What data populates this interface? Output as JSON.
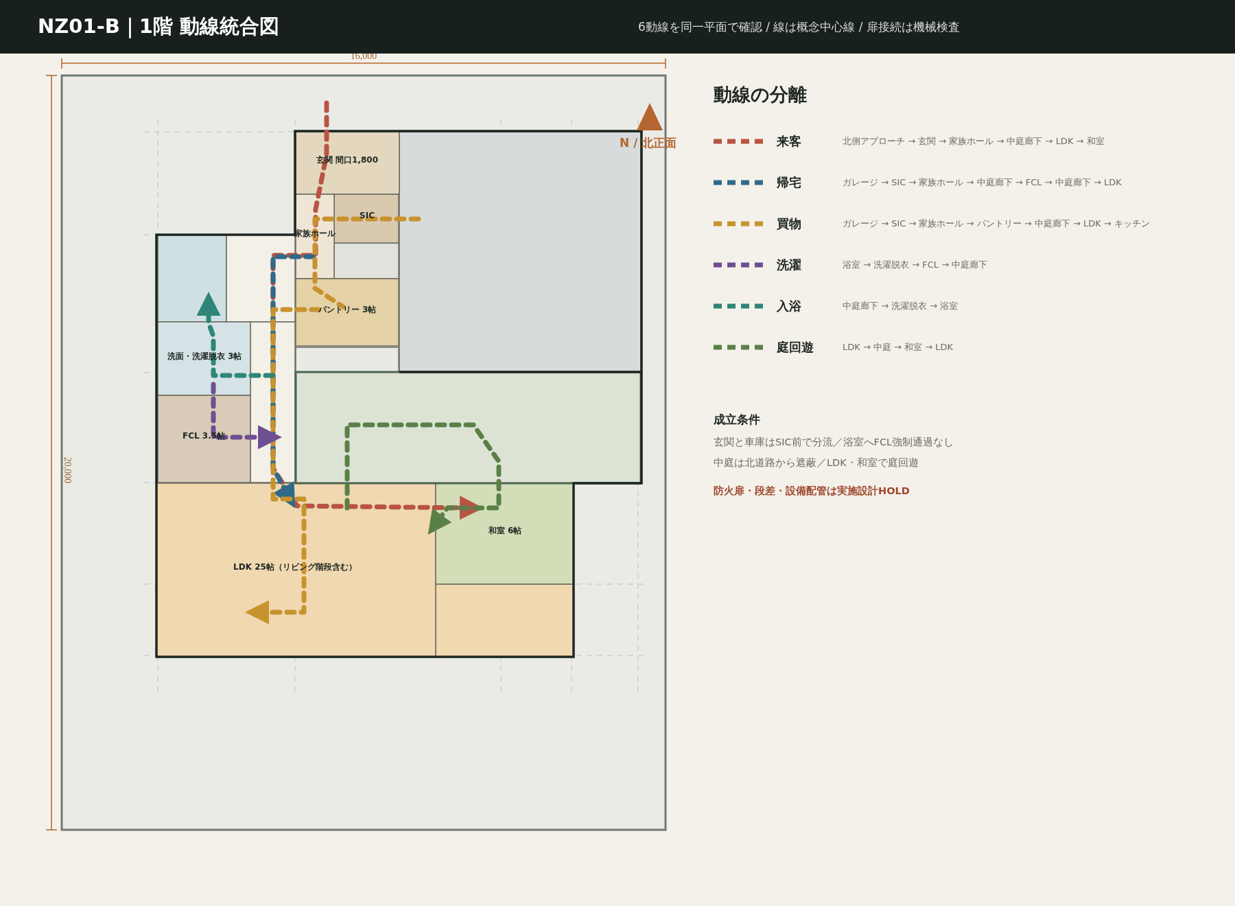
{
  "header": {
    "title": "NZ01-B｜1階 動線統合図",
    "subtitle": "6動線を同一平面で確認 / 線は概念中心線 / 扉接続は機械検査"
  },
  "plan": {
    "width_dimension": "16,000",
    "depth_dimension": "20,000",
    "north_label": "N / 北正面",
    "rooms": [
      {
        "label": "玄関 間口1,800",
        "color": "#e3d7bd"
      },
      {
        "label": "SIC",
        "color": "#d9c9ae"
      },
      {
        "label": "家族ホール",
        "color": "#efe5d5"
      },
      {
        "label": "パントリー 3帖",
        "color": "#e5d2a6"
      },
      {
        "label": "洗面・洗濯脱衣 3帖",
        "color": "#d6e3e6"
      },
      {
        "label": "FCL 3.5帖",
        "color": "#d8cbb8"
      },
      {
        "label": "LDK 25帖（リビング階段含む）",
        "color": "#f0d8b0"
      },
      {
        "label": "和室 6帖",
        "color": "#d3deb9"
      }
    ]
  },
  "legend": {
    "title": "動線の分離",
    "routes": [
      {
        "name": "来客",
        "path": "北側アプローチ → 玄関 → 家族ホール → 中庭廊下 → LDK → 和室",
        "color": "#b85443"
      },
      {
        "name": "帰宅",
        "path": "ガレージ → SIC → 家族ホール → 中庭廊下 → FCL → 中庭廊下 → LDK",
        "color": "#2f6a8a"
      },
      {
        "name": "買物",
        "path": "ガレージ → SIC → 家族ホール → パントリー → 中庭廊下 → LDK → キッチン",
        "color": "#c8922e"
      },
      {
        "name": "洗濯",
        "path": "浴室 → 洗濯脱衣 → FCL → 中庭廊下",
        "color": "#6f4f93"
      },
      {
        "name": "入浴",
        "path": "中庭廊下 → 洗濯脱衣 → 浴室",
        "color": "#2e8578"
      },
      {
        "name": "庭回遊",
        "path": "LDK → 中庭 → 和室 → LDK",
        "color": "#5a8048"
      }
    ]
  },
  "conditions": {
    "title": "成立条件",
    "items": [
      "玄関と車庫はSIC前で分流／浴室へFCL強制通過なし",
      "中庭は北道路から遮蔽／LDK・和室で庭回遊"
    ],
    "warning": "防火扉・段差・設備配管は実施設計HOLD"
  }
}
